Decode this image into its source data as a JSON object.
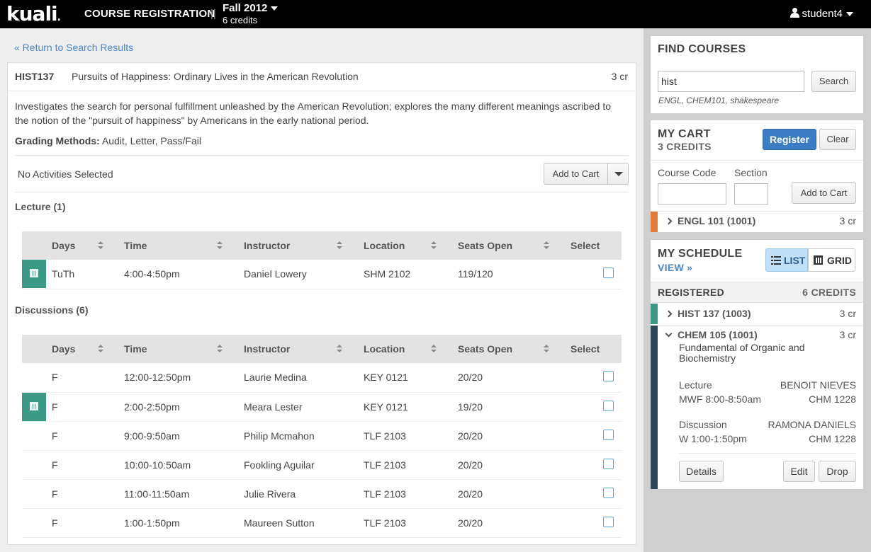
{
  "header": {
    "logo": "kuali",
    "app_title": "COURSE REGISTRATION",
    "separator": "||",
    "term": "Fall 2012",
    "term_credits": "6 credits",
    "user": "student4"
  },
  "nav": {
    "return_link": "« Return to Search Results"
  },
  "course": {
    "code": "HIST137",
    "title": "Pursuits of Happiness: Ordinary Lives in the American Revolution",
    "credits": "3 cr",
    "description": "Investigates the search for personal fulfillment unleashed by the American Revolution; explores the many different meanings ascribed to the notion of the \"pursuit of happiness\" by Americans in the early national period.",
    "grading_label": "Grading Methods:",
    "grading_value": "Audit, Letter, Pass/Fail",
    "activities_status": "No Activities Selected",
    "add_to_cart": "Add to Cart"
  },
  "columns": [
    "Days",
    "Time",
    "Instructor",
    "Location",
    "Seats Open",
    "Select"
  ],
  "lecture": {
    "title": "Lecture (1)",
    "rows": [
      {
        "days": "TuTh",
        "time": "4:00-4:50pm",
        "instructor": "Daniel Lowery",
        "location": "SHM 2102",
        "seats": "119/120",
        "conflict": true
      }
    ]
  },
  "discussions": {
    "title": "Discussions (6)",
    "rows": [
      {
        "days": "F",
        "time": "12:00-12:50pm",
        "instructor": "Laurie Medina",
        "location": "KEY 0121",
        "seats": "20/20",
        "conflict": false
      },
      {
        "days": "F",
        "time": "2:00-2:50pm",
        "instructor": "Meara Lester",
        "location": "KEY 0121",
        "seats": "19/20",
        "conflict": true
      },
      {
        "days": "F",
        "time": "9:00-9:50am",
        "instructor": "Philip Mcmahon",
        "location": "TLF 2103",
        "seats": "20/20",
        "conflict": false
      },
      {
        "days": "F",
        "time": "10:00-10:50am",
        "instructor": "Fookling Aguilar",
        "location": "TLF 2103",
        "seats": "20/20",
        "conflict": false
      },
      {
        "days": "F",
        "time": "11:00-11:50am",
        "instructor": "Julie Rivera",
        "location": "TLF 2103",
        "seats": "20/20",
        "conflict": false
      },
      {
        "days": "F",
        "time": "1:00-1:50pm",
        "instructor": "Maureen Sutton",
        "location": "TLF 2103",
        "seats": "20/20",
        "conflict": false
      }
    ]
  },
  "find_courses": {
    "title": "FIND COURSES",
    "query": "hist",
    "search_button": "Search",
    "hint": "ENGL, CHEM101, shakespeare"
  },
  "cart": {
    "title": "MY CART",
    "credits": "3 CREDITS",
    "register_button": "Register",
    "clear_button": "Clear",
    "course_code_label": "Course Code",
    "section_label": "Section",
    "add_button": "Add to Cart",
    "items": [
      {
        "name": "ENGL 101 (1001)",
        "credits": "3 cr",
        "color": "#e07b39"
      }
    ]
  },
  "schedule": {
    "title": "MY SCHEDULE",
    "view_link": "VIEW »",
    "list_label": "LIST",
    "grid_label": "GRID",
    "registered_label": "REGISTERED",
    "registered_credits": "6 CREDITS",
    "courses": [
      {
        "name": "HIST 137 (1003)",
        "credits": "3 cr",
        "color": "#3b9a86"
      },
      {
        "name": "CHEM 105 (1001)",
        "credits": "3 cr",
        "color": "#2e4756",
        "title": "Fundamental of Organic and Biochemistry",
        "lecture_type": "Lecture",
        "lecture_instructor": "BENOIT NIEVES",
        "lecture_time": "MWF 8:00-8:50am",
        "lecture_room": "CHM 1228",
        "discussion_type": "Discussion",
        "discussion_instructor": "RAMONA DANIELS",
        "discussion_time": "W 1:00-1:50pm",
        "discussion_room": "CHM 1228"
      }
    ],
    "details_button": "Details",
    "edit_button": "Edit",
    "drop_button": "Drop"
  },
  "colors": {
    "accent": "#3b7dc4",
    "conflict": "#3b9a86",
    "link": "#4a86c8"
  }
}
